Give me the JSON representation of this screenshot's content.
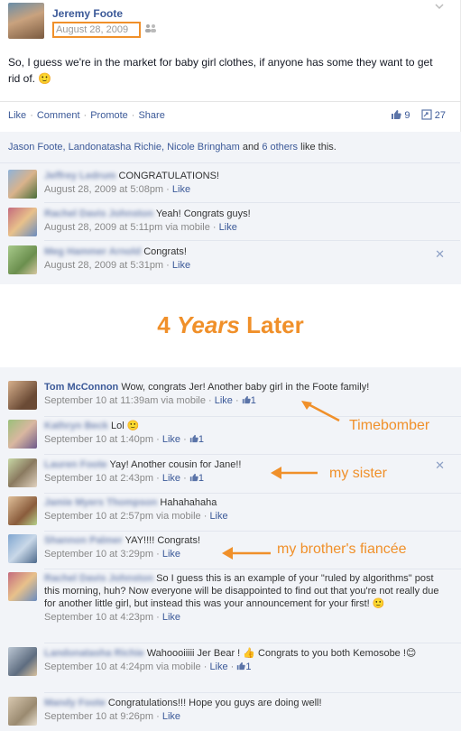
{
  "post": {
    "author": "Jeremy Foote",
    "date": "August 28, 2009",
    "audience_icon": "people-icon",
    "status": "So, I guess we're in the market for baby girl clothes, if anyone has some they want to get rid of. 🙂",
    "actions": [
      "Like",
      "Comment",
      "Promote",
      "Share"
    ],
    "likes_count": "9",
    "shares_count": "27",
    "likes_line_names": "Jason Foote, Landonatasha Richie, Nicole Bringham",
    "likes_line_and": "and",
    "likes_line_others": "6 others",
    "likes_line_tail": "like this."
  },
  "old_comments": [
    {
      "name": "Jeffrey Ledrum",
      "text": "CONGRATULATIONS!",
      "meta": "August 28, 2009 at 5:08pm",
      "like": "Like"
    },
    {
      "name": "Rachel Davis Johnston",
      "text": "Yeah! Congrats guys!",
      "meta": "August 28, 2009 at 5:11pm via mobile",
      "like": "Like"
    },
    {
      "name": "Meg Hammer Arnold",
      "text": "Congrats!",
      "meta": "August 28, 2009 at 5:31pm",
      "like": "Like"
    }
  ],
  "banner": {
    "num": "4",
    "word": "Years",
    "tail": "Later"
  },
  "new_comments": [
    {
      "name": "Tom McConnon",
      "text": "Wow, congrats Jer! Another baby girl in the Foote family!",
      "meta": "September 10 at 11:39am via mobile",
      "like": "Like",
      "likes": "1"
    },
    {
      "name": "Kathryn Beck",
      "text": "Lol 🙂",
      "meta": "September 10 at 1:40pm",
      "like": "Like",
      "likes": "1"
    },
    {
      "name": "Lauren Foote",
      "text": "Yay! Another cousin for Jane!!",
      "meta": "September 10 at 2:43pm",
      "like": "Like",
      "likes": "1"
    },
    {
      "name": "Jamie Myers Thompson",
      "text": "Hahahahaha",
      "meta": "September 10 at 2:57pm via mobile",
      "like": "Like"
    },
    {
      "name": "Shannon Palmer",
      "text": "YAY!!!! Congrats!",
      "meta": "September 10 at 3:29pm",
      "like": "Like"
    },
    {
      "name": "Rachel Davis Johnston",
      "text": "So I guess this is an example of your \"ruled by algorithms\" post this morning, huh? Now everyone will be disappointed to find out that you're not really due for another little girl, but instead this was your announcement for your first! 🙂",
      "meta": "September 10 at 4:23pm",
      "like": "Like"
    },
    {
      "name": "Landonatasha Richie",
      "text": "Wahoooiiiii Jer Bear ! 👍 Congrats to you both Kemosobe !😊",
      "meta": "September 10 at 4:24pm via mobile",
      "like": "Like",
      "likes": "1"
    },
    {
      "name": "Mandy Foote",
      "text": "Congratulations!!! Hope you guys are doing well!",
      "meta": "September 10 at 9:26pm",
      "like": "Like"
    }
  ],
  "annotations": {
    "timebomber": "Timebomber",
    "sister": "my sister",
    "fiancee": "my brother's fiancée"
  },
  "colors": {
    "accent": "#f0902a",
    "link": "#3b5998"
  }
}
